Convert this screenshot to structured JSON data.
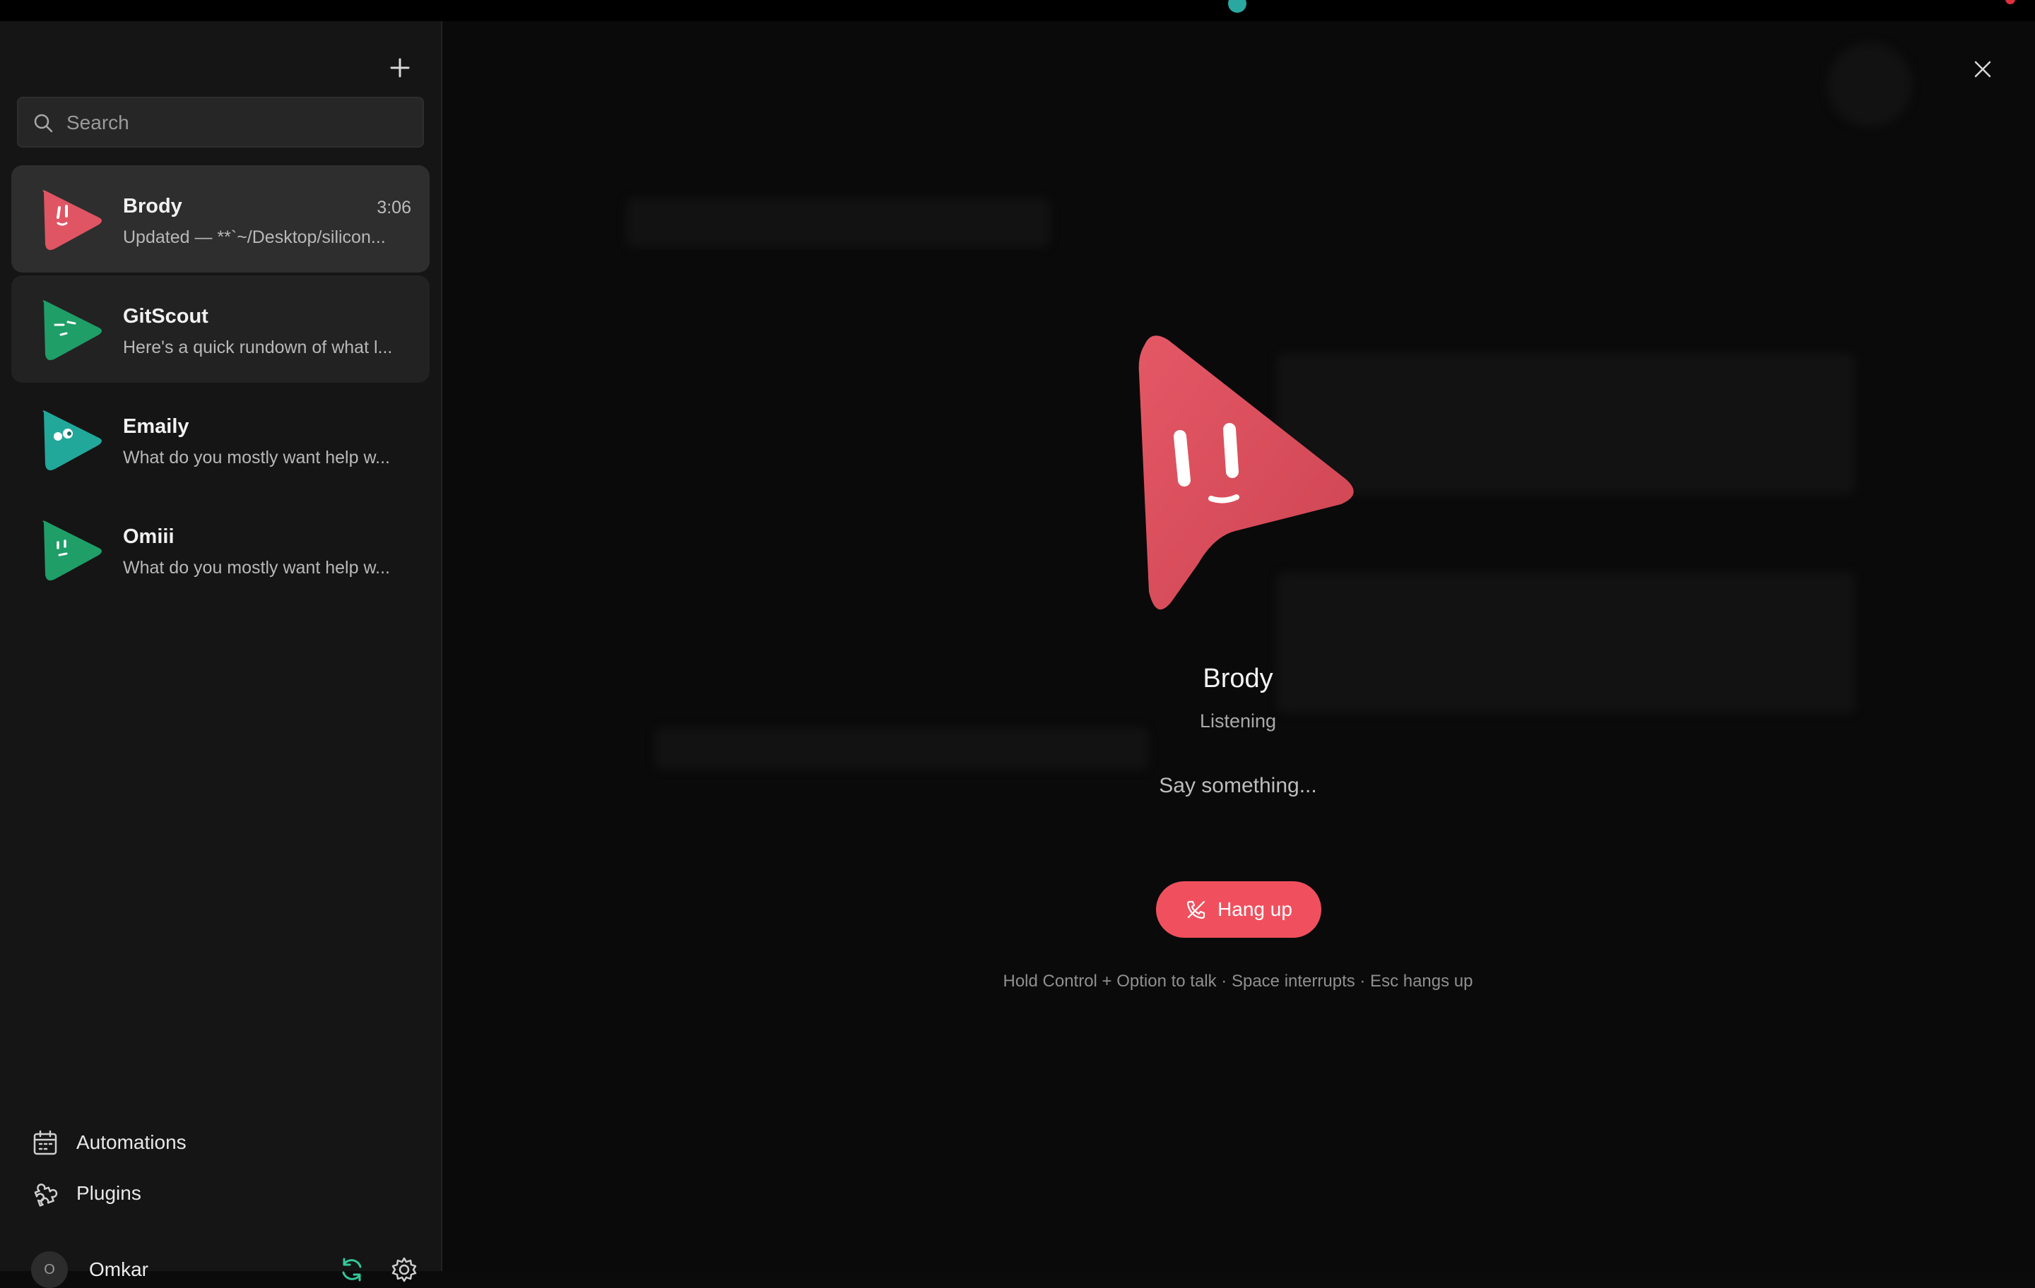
{
  "colors": {
    "accent_red": "#f0505e",
    "sync_green": "#34c79a",
    "brody_avatar": "#e05563",
    "gitscout_avatar": "#1f9e68",
    "emaily_avatar": "#22a89a",
    "omiii_avatar": "#1f9e68"
  },
  "sidebar": {
    "search": {
      "placeholder": "Search"
    },
    "chats": [
      {
        "name": "Brody",
        "time": "3:06",
        "preview": "Updated — **`~/Desktop/silicon...",
        "avatar_icon": "brody-avatar-icon"
      },
      {
        "name": "GitScout",
        "time": "",
        "preview": "Here's a quick rundown of what l...",
        "avatar_icon": "gitscout-avatar-icon"
      },
      {
        "name": "Emaily",
        "time": "",
        "preview": "What do you mostly want help w...",
        "avatar_icon": "emaily-avatar-icon"
      },
      {
        "name": "Omiii",
        "time": "",
        "preview": "What do you mostly want help w...",
        "avatar_icon": "omiii-avatar-icon"
      }
    ],
    "nav": {
      "automations": "Automations",
      "plugins": "Plugins"
    },
    "user": {
      "initial": "O",
      "name": "Omkar"
    }
  },
  "call": {
    "name": "Brody",
    "status": "Listening",
    "prompt": "Say something...",
    "hangup_label": "Hang up",
    "hint": "Hold Control + Option to talk · Space interrupts · Esc hangs up"
  }
}
